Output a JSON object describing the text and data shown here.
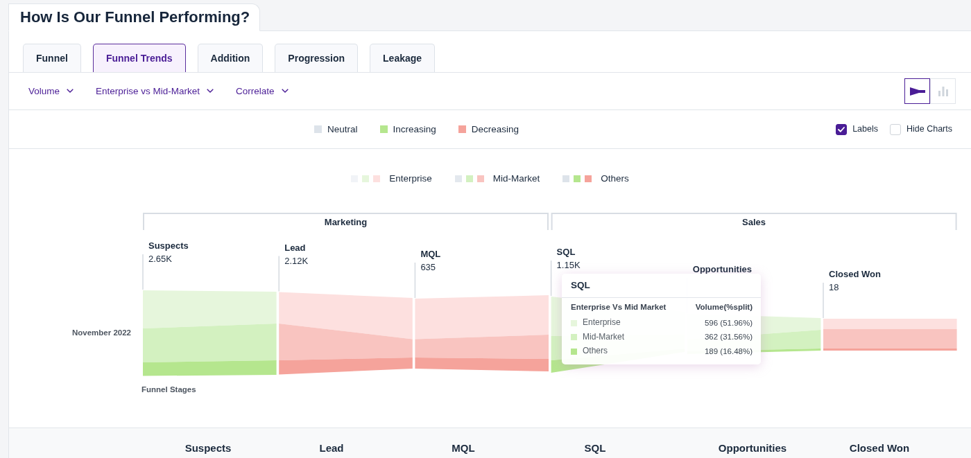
{
  "header": {
    "title": "How Is Our Funnel Performing?"
  },
  "tabs": [
    {
      "label": "Funnel",
      "selected": false
    },
    {
      "label": "Funnel Trends",
      "selected": true
    },
    {
      "label": "Addition",
      "selected": false
    },
    {
      "label": "Progression",
      "selected": false
    },
    {
      "label": "Leakage",
      "selected": false
    }
  ],
  "filters": [
    {
      "label": "Volume"
    },
    {
      "label": "Enterprise vs Mid-Market"
    },
    {
      "label": "Correlate"
    }
  ],
  "view_toggle": [
    {
      "kind": "funnel",
      "selected": true
    },
    {
      "kind": "bar",
      "selected": false
    }
  ],
  "trend_legend": [
    {
      "label": "Neutral",
      "color": "#dde3ea"
    },
    {
      "label": "Increasing",
      "color": "#b5e68e"
    },
    {
      "label": "Decreasing",
      "color": "#f5a39b"
    }
  ],
  "options": [
    {
      "label": "Labels",
      "checked": true
    },
    {
      "label": "Hide Charts",
      "checked": false
    }
  ],
  "chart": {
    "series_legend": [
      {
        "label": "Enterprise",
        "swatches": [
          {
            "color": "#f1f3f7"
          },
          {
            "color": "#e6f6dc"
          },
          {
            "color": "#fde0df"
          }
        ]
      },
      {
        "label": "Mid-Market",
        "swatches": [
          {
            "color": "#e3e8ee"
          },
          {
            "color": "#d3f1c0"
          },
          {
            "color": "#f9c4c0"
          }
        ]
      },
      {
        "label": "Others",
        "swatches": [
          {
            "color": "#dde3ea"
          },
          {
            "color": "#b5e68e"
          },
          {
            "color": "#f5a39b"
          }
        ]
      }
    ],
    "groups": [
      {
        "label": "Marketing"
      },
      {
        "label": "Sales"
      }
    ],
    "row_label": "November 2022",
    "axis_label": "Funnel Stages",
    "stages": [
      {
        "name": "Suspects",
        "value": "2.65K",
        "kind": "increasing"
      },
      {
        "name": "Lead",
        "value": "2.12K",
        "kind": "decreasing"
      },
      {
        "name": "MQL",
        "value": "635",
        "kind": "decreasing"
      },
      {
        "name": "SQL",
        "value": "1.15K",
        "kind": "increasing"
      },
      {
        "name": "Opportunities",
        "kind": "increasing"
      },
      {
        "name": "Closed Won",
        "value": "18",
        "kind": "decreasing"
      }
    ],
    "tooltip": {
      "title": "SQL",
      "columns": [
        "Enterprise Vs Mid Market",
        "Volume(%split)"
      ],
      "rows": [
        {
          "label": "Enterprise",
          "value": "596 (51.96%)",
          "color": "#e6f6dc"
        },
        {
          "label": "Mid-Market",
          "value": "362 (31.56%)",
          "color": "#d3f1c0"
        },
        {
          "label": "Others",
          "value": "189 (16.48%)",
          "color": "#b5e68e"
        }
      ]
    }
  },
  "table": {
    "columns": [
      "Suspects",
      "Lead",
      "MQL",
      "SQL",
      "Opportunities",
      "Closed Won"
    ]
  }
}
